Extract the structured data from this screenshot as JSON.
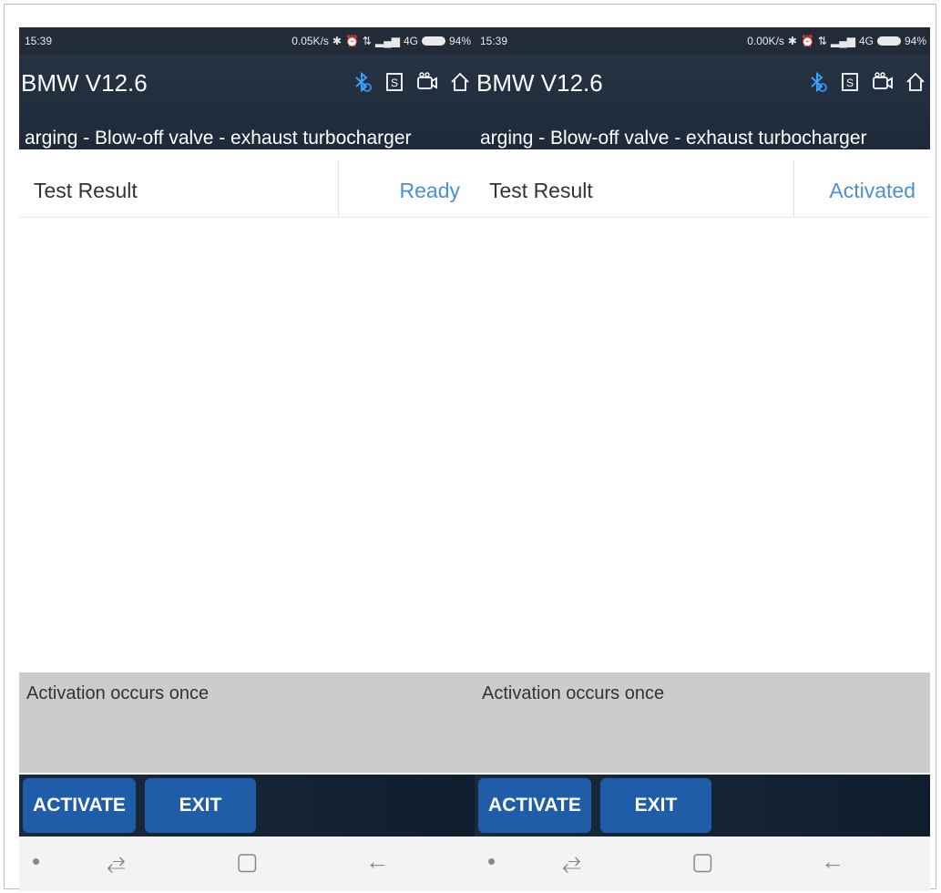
{
  "screens": [
    {
      "status": {
        "time": "15:39",
        "speed": "0.05K/s",
        "network": "4G",
        "battery": "94%"
      },
      "app": {
        "title": "BMW V12.6",
        "subtitle": "arging - Blow-off valve - exhaust turbocharger"
      },
      "result": {
        "label": "Test Result",
        "value": "Ready"
      },
      "note": "Activation occurs once",
      "buttons": {
        "activate": "ACTIVATE",
        "exit": "EXIT"
      }
    },
    {
      "status": {
        "time": "15:39",
        "speed": "0.00K/s",
        "network": "4G",
        "battery": "94%"
      },
      "app": {
        "title": "BMW V12.6",
        "subtitle": "arging - Blow-off valve - exhaust turbocharger"
      },
      "result": {
        "label": "Test Result",
        "value": "Activated"
      },
      "note": "Activation occurs once",
      "buttons": {
        "activate": "ACTIVATE",
        "exit": "EXIT"
      }
    }
  ],
  "icons": {
    "statusbar": [
      "bluetooth-icon",
      "alarm-icon",
      "data-transfer-icon",
      "signal-icon",
      "battery-icon"
    ],
    "appbar": [
      "bluetooth-icon",
      "screenshot-icon",
      "video-record-icon",
      "home-icon"
    ],
    "navbar": [
      "dot-icon",
      "menu-icon",
      "home-icon",
      "back-icon"
    ]
  },
  "colors": {
    "accent": "#4a90d9",
    "button": "#1f5da8",
    "appbar": "#263344",
    "note_bg": "#cccccc"
  }
}
